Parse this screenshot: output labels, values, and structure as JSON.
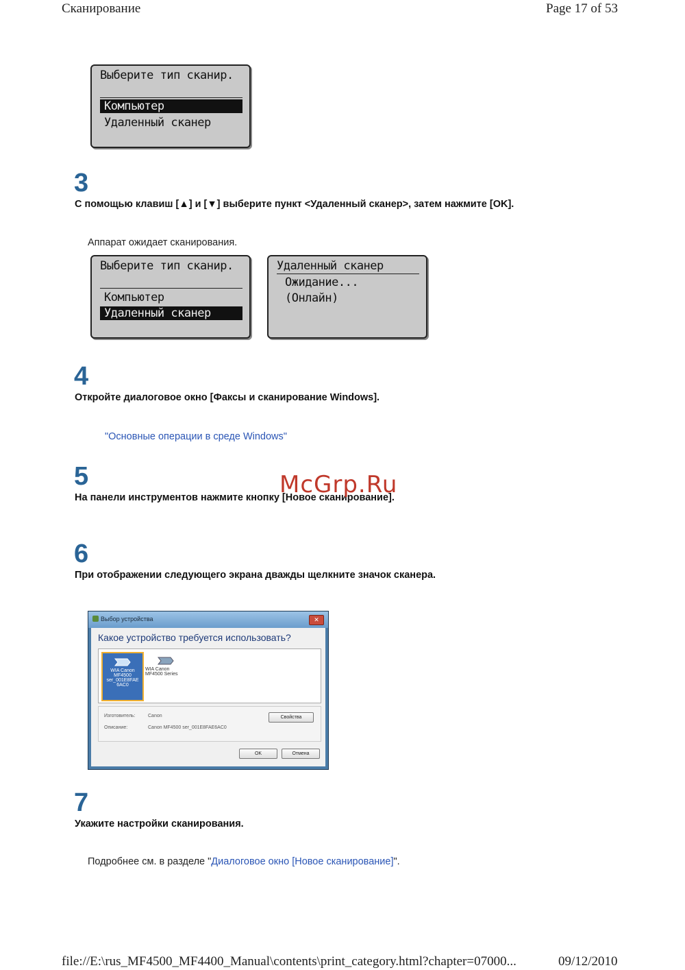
{
  "header": {
    "title": "Сканирование",
    "page": "Page 17 of 53"
  },
  "lcd1": {
    "line1": "Выберите тип сканир.",
    "item1": "Компьютер",
    "item2": "Удаленный сканер"
  },
  "step3": {
    "number": "3",
    "instruction": "С помощью клавиш [▲] и [▼] выберите пункт <Удаленный сканер>, затем нажмите [OK].",
    "note": "Аппарат ожидает сканирования."
  },
  "lcd2": {
    "line1": "Выберите тип сканир.",
    "item1": "Компьютер",
    "item2": "Удаленный сканер"
  },
  "lcd3": {
    "line1": "Удаленный сканер",
    "line2": "Ожидание...",
    "line3": "(Онлайн)"
  },
  "step4": {
    "number": "4",
    "instruction": "Откройте диалоговое окно [Факсы и сканирование Windows].",
    "link": "\"Основные операции в среде Windows\""
  },
  "step5": {
    "number": "5",
    "instruction": "На панели инструментов нажмите кнопку [Новое сканирование]."
  },
  "watermark": "McGrp.Ru",
  "step6": {
    "number": "6",
    "instruction": "При отображении следующего экрана дважды щелкните значок сканера."
  },
  "dialog": {
    "title": "Выбор устройства",
    "close": "✕",
    "question": "Какое устройство требуется использовать?",
    "device1": "WIA Canon MF4500 ser_001E8FAE 6AC0",
    "device2": "WIA Canon MF4500 Series",
    "manufacturer_label": "Изготовитель:",
    "manufacturer_value": "Canon",
    "description_label": "Описание:",
    "description_value": "Canon MF4500 ser_001E8FAE6AC0",
    "properties_button": "Свойства",
    "ok_button": "OK",
    "cancel_button": "Отмена"
  },
  "step7": {
    "number": "7",
    "instruction": "Укажите настройки сканирования.",
    "note_prefix": "Подробнее см. в разделе \"",
    "note_link": "Диалоговое окно [Новое сканирование]",
    "note_suffix": "\"."
  },
  "footer": {
    "path": "file://E:\\rus_MF4500_MF4400_Manual\\contents\\print_category.html?chapter=07000...",
    "date": "09/12/2010"
  },
  "colors": {
    "step_number": "#2a6496",
    "link": "#2a55b5",
    "watermark": "#c0392b"
  }
}
